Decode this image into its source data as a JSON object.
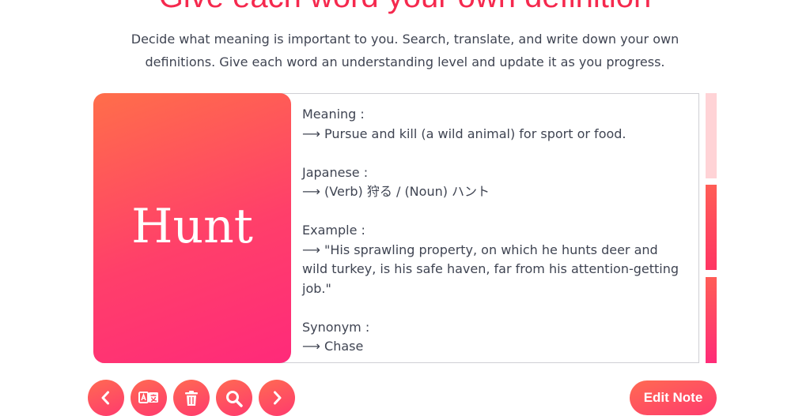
{
  "hero": {
    "title": "Give each word your own definition",
    "subtitle_line1": "Decide what meaning is important to you. Search, translate, and write down your own",
    "subtitle_line2": "definitions. Give each word an understanding level and update it as you progress."
  },
  "card": {
    "word": "Hunt"
  },
  "note": {
    "meaning_label": "Meaning :",
    "meaning_text": "⟶ Pursue and kill (a wild animal) for sport or food.",
    "japanese_label": "Japanese :",
    "japanese_text": "⟶ (Verb) 狩る / (Noun) ハント",
    "example_label": "Example :",
    "example_text": "⟶ \"His sprawling property, on which he hunts deer and wild turkey, is his safe haven, far from his attention-getting job.\"",
    "synonym_label": "Synonym :",
    "synonym_text": "⟶ Chase"
  },
  "toolbar": {
    "buttons": [
      {
        "icon": "chevron-left-icon"
      },
      {
        "icon": "translate-icon"
      },
      {
        "icon": "trash-icon"
      },
      {
        "icon": "search-icon"
      },
      {
        "icon": "chevron-right-icon"
      }
    ],
    "edit_label": "Edit Note"
  },
  "colors": {
    "accent": "#f5294e",
    "gradient_start": "#ff6e4a",
    "gradient_end": "#ff2a7a",
    "text": "#3f4452"
  }
}
